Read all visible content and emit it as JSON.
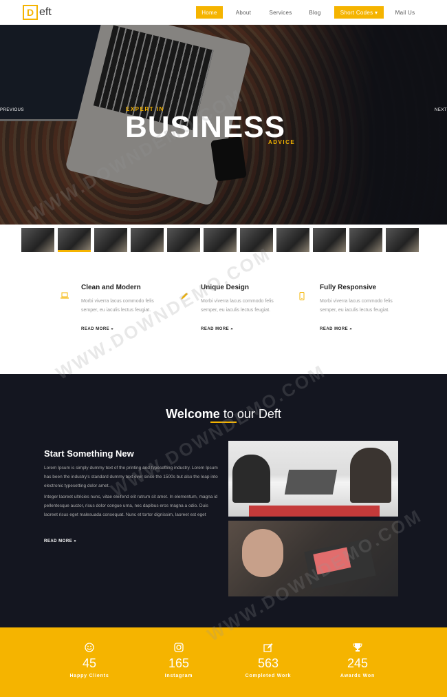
{
  "logo": {
    "letter": "D",
    "rest": "eft"
  },
  "nav": {
    "items": [
      {
        "label": "Home"
      },
      {
        "label": "About"
      },
      {
        "label": "Services"
      },
      {
        "label": "Blog"
      },
      {
        "label": "Short Codes ▾"
      },
      {
        "label": "Mail Us"
      }
    ],
    "active_index": 0
  },
  "hero": {
    "kicker": "EXPERT IN",
    "title": "BUSINESS",
    "subtitle": "ADVICE",
    "prev": "PREVIOUS",
    "next": "NEXT"
  },
  "thumbnails": {
    "count": 11,
    "active_index": 1
  },
  "features": [
    {
      "icon": "laptop-icon",
      "title": "Clean and Modern",
      "text": "Morbi viverra lacus commodo felis semper, eu iaculis lectus feugiat.",
      "link": "READ MORE »"
    },
    {
      "icon": "pen-icon",
      "title": "Unique Design",
      "text": "Morbi viverra lacus commodo felis semper, eu iaculis lectus feugiat.",
      "link": "READ MORE »"
    },
    {
      "icon": "mobile-icon",
      "title": "Fully Responsive",
      "text": "Morbi viverra lacus commodo felis semper, eu iaculis lectus feugiat.",
      "link": "READ MORE »"
    }
  ],
  "welcome": {
    "title_bold": "Welcome",
    "title_rest": " to our Deft",
    "heading": "Start Something New",
    "p1": "Lorem Ipsum is simply dummy text of the printing and typesetting industry. Lorem Ipsum has been the industry's standard dummy text ever since the 1500s but also the leap into electronic typesetting dolor amet.",
    "p2": "Integer laoreet ultricies nunc, vitae eleifend elit rutrum sit amet. In elementum, magna id pellentesque auctor, risus dolor congue urna, nec dapibus eros magna a odio. Duis laoreet risus eget malesuada consequat. Nunc et tortor dignissim, laoreet est eget",
    "link": "READ MORE »"
  },
  "stats": [
    {
      "icon": "smile-icon",
      "value": "45",
      "label": "Happy Clients"
    },
    {
      "icon": "instagram-icon",
      "value": "165",
      "label": "Instagram"
    },
    {
      "icon": "edit-icon",
      "value": "563",
      "label": "Completed Work"
    },
    {
      "icon": "trophy-icon",
      "value": "245",
      "label": "Awards Won"
    }
  ],
  "watermark": "WWW.DOWNDEMO.COM",
  "colors": {
    "accent": "#f5b400",
    "dark": "#141620"
  }
}
